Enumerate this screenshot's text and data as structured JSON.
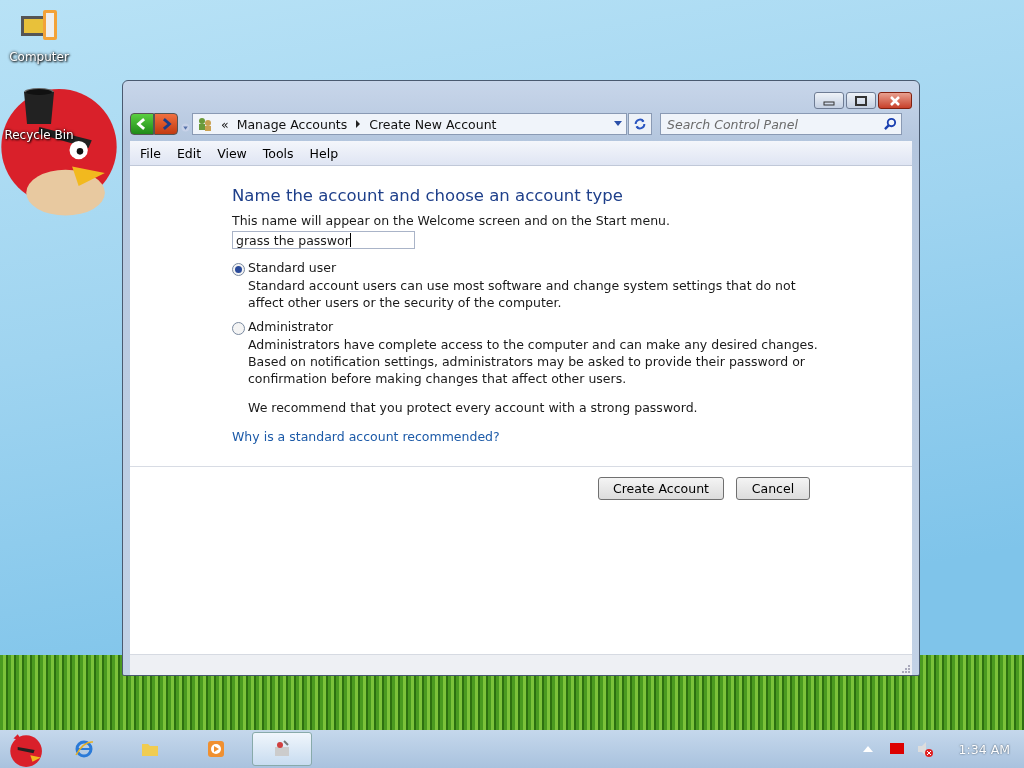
{
  "desktop_icons": [
    {
      "label": "Computer",
      "kind": "computer"
    },
    {
      "label": "Recycle Bin",
      "kind": "bin"
    }
  ],
  "window": {
    "address": {
      "prefix": "«",
      "crumbs": [
        "Manage Accounts",
        "Create New Account"
      ]
    },
    "search": {
      "placeholder": "Search Control Panel"
    },
    "menu": [
      "File",
      "Edit",
      "View",
      "Tools",
      "Help"
    ],
    "content": {
      "heading": "Name the account and choose an account type",
      "intro": "This name will appear on the Welcome screen and on the Start menu.",
      "name_field": {
        "value": "grass the passwor"
      },
      "options": [
        {
          "label": "Standard user",
          "selected": true,
          "description": "Standard account users can use most software and change system settings that do not affect other users or the security of the computer."
        },
        {
          "label": "Administrator",
          "selected": false,
          "description": "Administrators have complete access to the computer and can make any desired changes. Based on notification settings, administrators may be asked to provide their password or confirmation before making changes that affect other users."
        }
      ],
      "note": "We recommend that you protect every account with a strong password.",
      "link": "Why is a standard account recommended?"
    },
    "buttons": [
      "Create Account",
      "Cancel"
    ]
  },
  "taskbar": {
    "items": [
      {
        "kind": "browser",
        "selected": false
      },
      {
        "kind": "folder",
        "selected": false
      },
      {
        "kind": "media",
        "selected": false
      },
      {
        "kind": "app",
        "selected": true
      }
    ],
    "clock": "1:34 AM"
  }
}
